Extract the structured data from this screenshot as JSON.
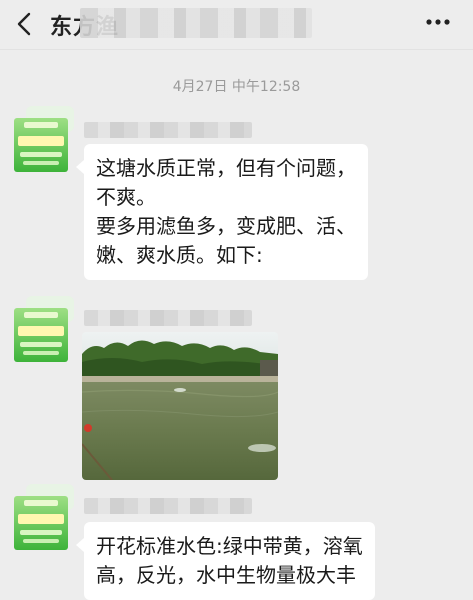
{
  "header": {
    "title": "东方渔",
    "back_icon": "chevron-left-icon",
    "more_icon": "more-dots-icon"
  },
  "timestamp": "4月27日 中午12:58",
  "messages": [
    {
      "type": "text",
      "lines": [
        "这塘水质正常，但有个问题，",
        "不爽。",
        "要多用滤鱼多，变成肥、活、",
        "嫩、爽水质。如下:"
      ]
    },
    {
      "type": "image",
      "description_icon": "pond-photo"
    },
    {
      "type": "text",
      "lines": [
        "开花标准水色:绿中带黄，溶氧",
        "高，反光，水中生物量极大丰"
      ]
    }
  ],
  "colors": {
    "background": "#ededed",
    "bubble": "#ffffff",
    "avatar_green": "#3db33a"
  }
}
